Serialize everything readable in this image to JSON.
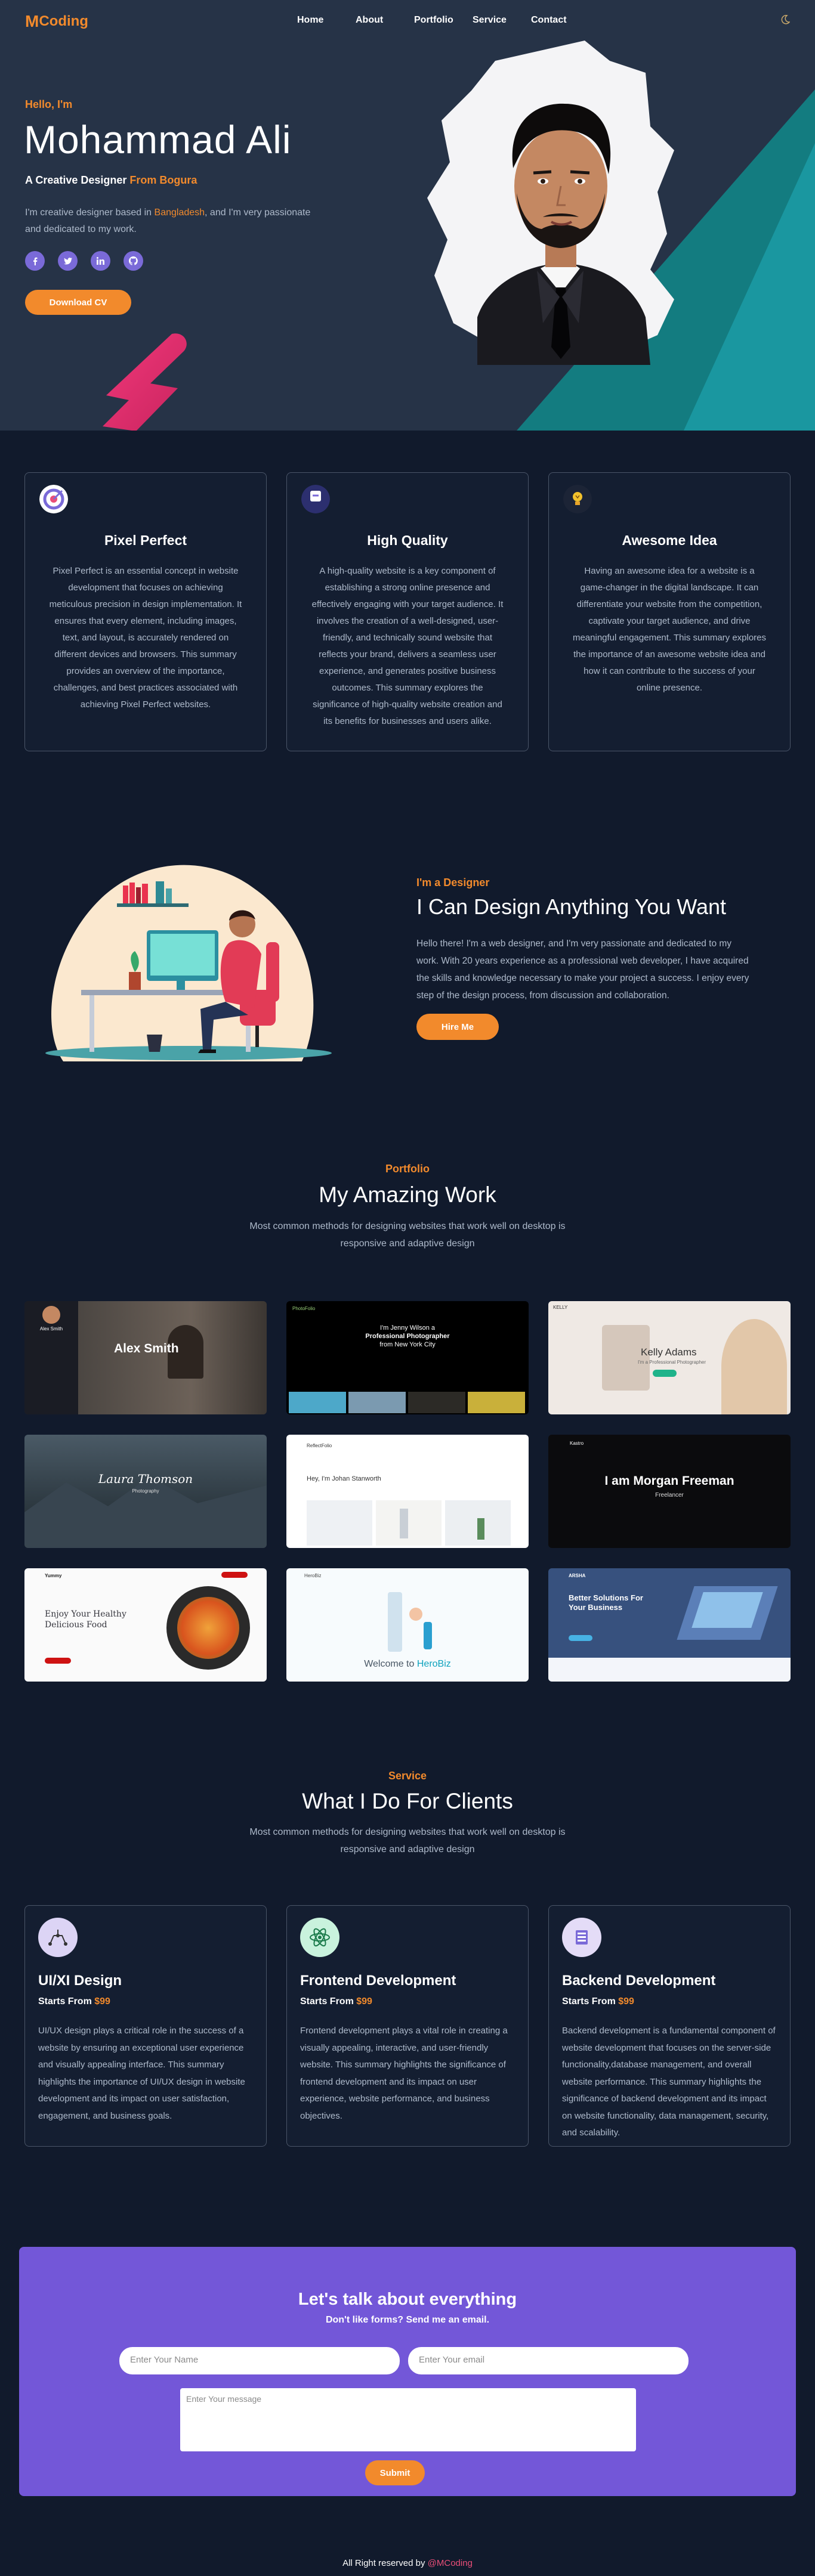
{
  "nav": {
    "logo_mark": "M",
    "logo_text": "Coding",
    "links": [
      "Home",
      "About",
      "Portfolio",
      "Service",
      "Contact"
    ]
  },
  "hero": {
    "greeting": "Hello, I'm",
    "name": "Mohammad Ali",
    "role_prefix": "A Creative Designer",
    "role_highlight": "From Bogura",
    "intro_pre": "I'm creative designer based in",
    "intro_highlight": "Bangladesh",
    "intro_post": ", and I'm very passionate and dedicated to my work.",
    "socials": [
      "f",
      "t",
      "in",
      "gh"
    ],
    "download_label": "Download CV"
  },
  "features": [
    {
      "title": "Pixel Perfect",
      "icon": "target-icon",
      "color": "#e94e78",
      "text": "Pixel Perfect is an essential concept in website development that focuses on achieving meticulous precision in design implementation. It ensures that every element, including images, text, and layout, is accurately rendered on different devices and browsers. This summary provides an overview of the importance, challenges, and best practices associated with achieving Pixel Perfect websites."
    },
    {
      "title": "High Quality",
      "icon": "quality-icon",
      "color": "#7a6ad8",
      "text": "A high-quality website is a key component of establishing a strong online presence and effectively engaging with your target audience. It involves the creation of a well-designed, user-friendly, and technically sound website that reflects your brand, delivers a seamless user experience, and generates positive business outcomes. This summary explores the significance of high-quality website creation and its benefits for businesses and users alike."
    },
    {
      "title": "Awesome Idea",
      "icon": "lightbulb-icon",
      "color": "#f2c12c",
      "text": "Having an awesome idea for a website is a game-changer in the digital landscape. It can differentiate your website from the competition, captivate your target audience, and drive meaningful engagement. This summary explores the importance of an awesome website idea and how it can contribute to the success of your online presence."
    }
  ],
  "designer": {
    "label": "I'm a Designer",
    "title": "I Can Design Anything You Want",
    "text": "Hello there! I'm a web designer, and I'm very passionate and dedicated to my work. With 20 years experience as a professional web developer, I have acquired the skills and knowledge necessary to make your project a success. I enjoy every step of the design process, from discussion and collaboration.",
    "button": "Hire Me"
  },
  "portfolio": {
    "label": "Portfolio",
    "title": "My Amazing Work",
    "subtitle": "Most common methods for designing websites that work well on desktop is responsive and adaptive design",
    "items": [
      {
        "caption": "Alex Smith",
        "theme": "dark-profile"
      },
      {
        "caption": "PhotoFolio",
        "theme": "photographer"
      },
      {
        "caption": "Kelly Adams",
        "theme": "light-profile"
      },
      {
        "caption": "Laura Thomson",
        "theme": "landscape"
      },
      {
        "caption": "Hey, I'm Johan Stanworth",
        "theme": "minimal"
      },
      {
        "caption": "I am Morgan Freeman",
        "theme": "dark-hero"
      },
      {
        "caption": "Enjoy Your Healthy Delicious Food",
        "theme": "food"
      },
      {
        "caption": "Welcome to HeroBiz",
        "theme": "herobiz"
      },
      {
        "caption": "Better Solutions For Your Business",
        "theme": "arsha"
      }
    ],
    "thumb_texts": {
      "t1_brand": "Alex Smith",
      "t2_brand": "PhotoFolio",
      "t2_h1": "I'm Jenny Wilson a",
      "t2_h2": "Professional Photographer",
      "t2_h3": "from New York City",
      "t3_brand": "KELLY",
      "t3_sub": "I'm a Professional Photographer",
      "t4_brand": "Laura Thomson",
      "t4_sub": "Photography",
      "t5_brand": "ReflectFolio",
      "t5_title": "Hey, I'm Johan Stanworth",
      "t6_brand": "Kastro",
      "t6_sub": "Freelancer",
      "t7_brand": "Yummy",
      "t7_line1": "Enjoy Your Healthy",
      "t7_line2": "Delicious Food",
      "t8_brand": "HeroBiz",
      "t8_pre": "Welcome to",
      "t8_hl": "HeroBiz",
      "t9_brand": "ARSHA",
      "t9_line1": "Better Solutions For",
      "t9_line2": "Your Business"
    }
  },
  "services": {
    "label": "Service",
    "title": "What I Do For Clients",
    "subtitle": "Most common methods for designing websites that work well on desktop is responsive and adaptive design",
    "price_prefix": "Starts From",
    "items": [
      {
        "title": "UI/XI Design",
        "price": "$99",
        "icon": "design-icon",
        "bg": "#dcd4f5",
        "text": "UI/UX design plays a critical role in the success of a website by ensuring an exceptional user experience and visually appealing interface. This summary highlights the importance of UI/UX design in website development and its impact on user satisfaction, engagement, and business goals."
      },
      {
        "title": "Frontend Development",
        "price": "$99",
        "icon": "atom-icon",
        "bg": "#c9f2dd",
        "text": "Frontend development plays a vital role in creating a visually appealing, interactive, and user-friendly website. This summary highlights the significance of frontend development and its impact on user experience, website performance, and business objectives."
      },
      {
        "title": "Backend Development",
        "price": "$99",
        "icon": "server-icon",
        "bg": "#e4dcf7",
        "text": "Backend development is a fundamental component of website development that focuses on the server-side functionality,database management, and overall website performance. This summary highlights the significance of backend development and its impact on website functionality, data management, security, and scalability."
      }
    ]
  },
  "contact": {
    "title": "Let's talk about everything",
    "subtitle": "Don't like forms? Send me an email.",
    "name_placeholder": "Enter Your Name",
    "email_placeholder": "Enter Your email",
    "message_placeholder": "Enter Your message",
    "submit": "Submit"
  },
  "footer": {
    "text": "All Right reserved by",
    "highlight": "@MCoding"
  }
}
